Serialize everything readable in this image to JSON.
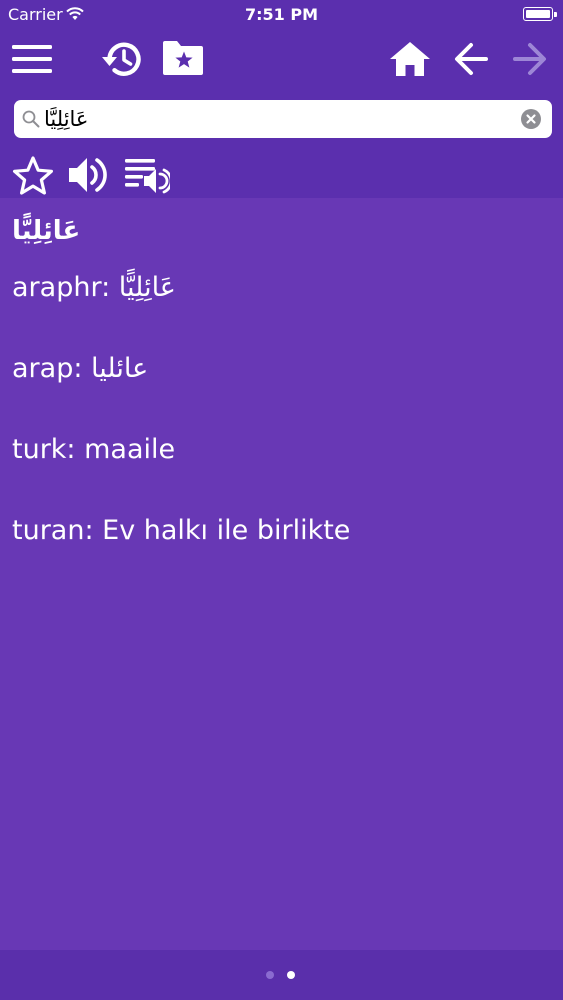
{
  "status_bar": {
    "carrier": "Carrier",
    "time": "7:51 PM"
  },
  "toolbar": {
    "icons": [
      "menu-icon",
      "history-icon",
      "favorites-folder-icon",
      "home-icon",
      "back-arrow-icon",
      "forward-arrow-icon"
    ],
    "forward_enabled": false
  },
  "search": {
    "value": "عَائِلِيًّا"
  },
  "actions": {
    "icons": [
      "star-icon",
      "speaker-icon",
      "playlist-speaker-icon"
    ]
  },
  "entry": {
    "headword": "عَائِلِيًّا",
    "lines": [
      "araphr: عَائِلِيًّا",
      "arap: عائليا",
      "turk: maaile",
      "turan: Ev halkı ile birlikte"
    ]
  },
  "pager": {
    "total": 2,
    "active": 2
  },
  "colors": {
    "bar": "#5b2fae",
    "content": "#6838b5",
    "text": "#ffffff"
  }
}
